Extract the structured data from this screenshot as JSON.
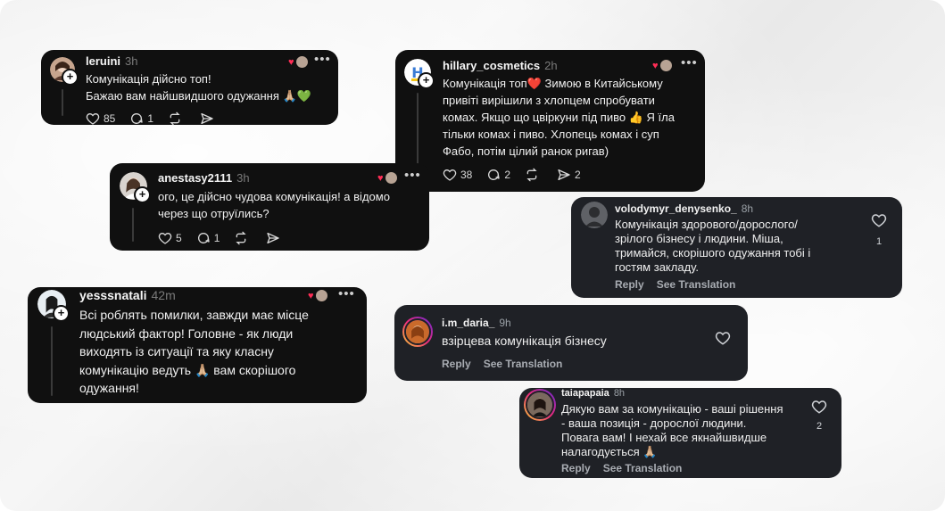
{
  "threads": [
    {
      "username": "leruini",
      "time": "3h",
      "lines": [
        "Комунікація дійсно топ!",
        "Бажаю вам найшвидшого одужання 🙏🏼💚"
      ],
      "likes": "85",
      "replies": "1",
      "reposts": "",
      "shares": ""
    },
    {
      "username": "hillary_cosmetics",
      "time": "2h",
      "lines": [
        "Комунікація топ❤️ Зимою в Китайському",
        "привіті вирішили з хлопцем спробувати",
        "комах. Якщо що цвіркуни під пиво 👍 Я їла",
        "тільки комах і пиво. Хлопець комах і суп",
        "Фабо, потім цілий ранок ригав)"
      ],
      "likes": "38",
      "replies": "2",
      "reposts": "",
      "shares": "2"
    },
    {
      "username": "anestasy2111",
      "time": "3h",
      "lines": [
        "ого, це дійсно чудова комунікація! а відомо",
        "через що отруїлись?"
      ],
      "likes": "5",
      "replies": "1",
      "reposts": "",
      "shares": ""
    },
    {
      "username": "yesssnatali",
      "time": "42m",
      "lines": [
        "Всі роблять помилки, завжди має місце",
        "людський фактор! Головне - як люди",
        "виходять із ситуації та яку класну",
        "комунікацію ведуть 🙏🏼 вам скорішого",
        "одужання!"
      ]
    }
  ],
  "ig_comments": [
    {
      "username": "volodymyr_denysenko_",
      "time": "8h",
      "lines": [
        "Комунікація здорового/дорослого/",
        "зрілого бізнесу і людини. Міша,",
        "тримайся, скорішого одужання тобі і",
        "гостям закладу."
      ],
      "likes": "1",
      "reply": "Reply",
      "translate": "See Translation"
    },
    {
      "username": "i.m_daria_",
      "time": "9h",
      "lines": [
        "взірцева комунікація бізнесу"
      ],
      "likes": "",
      "reply": "Reply",
      "translate": "See Translation"
    },
    {
      "username": "taiapapaia",
      "time": "8h",
      "lines": [
        "Дякую вам за комунікацію - ваші рішення",
        "- ваша позиція - дорослої людини.",
        "Повага вам! І нехай все якнайшвидше",
        "налагодується 🙏🏼"
      ],
      "likes": "2",
      "reply": "Reply",
      "translate": "See Translation"
    }
  ],
  "colors": {
    "threads_card": "#101010",
    "ig_card": "#1f2126",
    "like_heart": "#ff2d55"
  },
  "icons": [
    "heart-icon",
    "comment-icon",
    "repost-icon",
    "share-icon",
    "more-icon",
    "plus-icon"
  ]
}
